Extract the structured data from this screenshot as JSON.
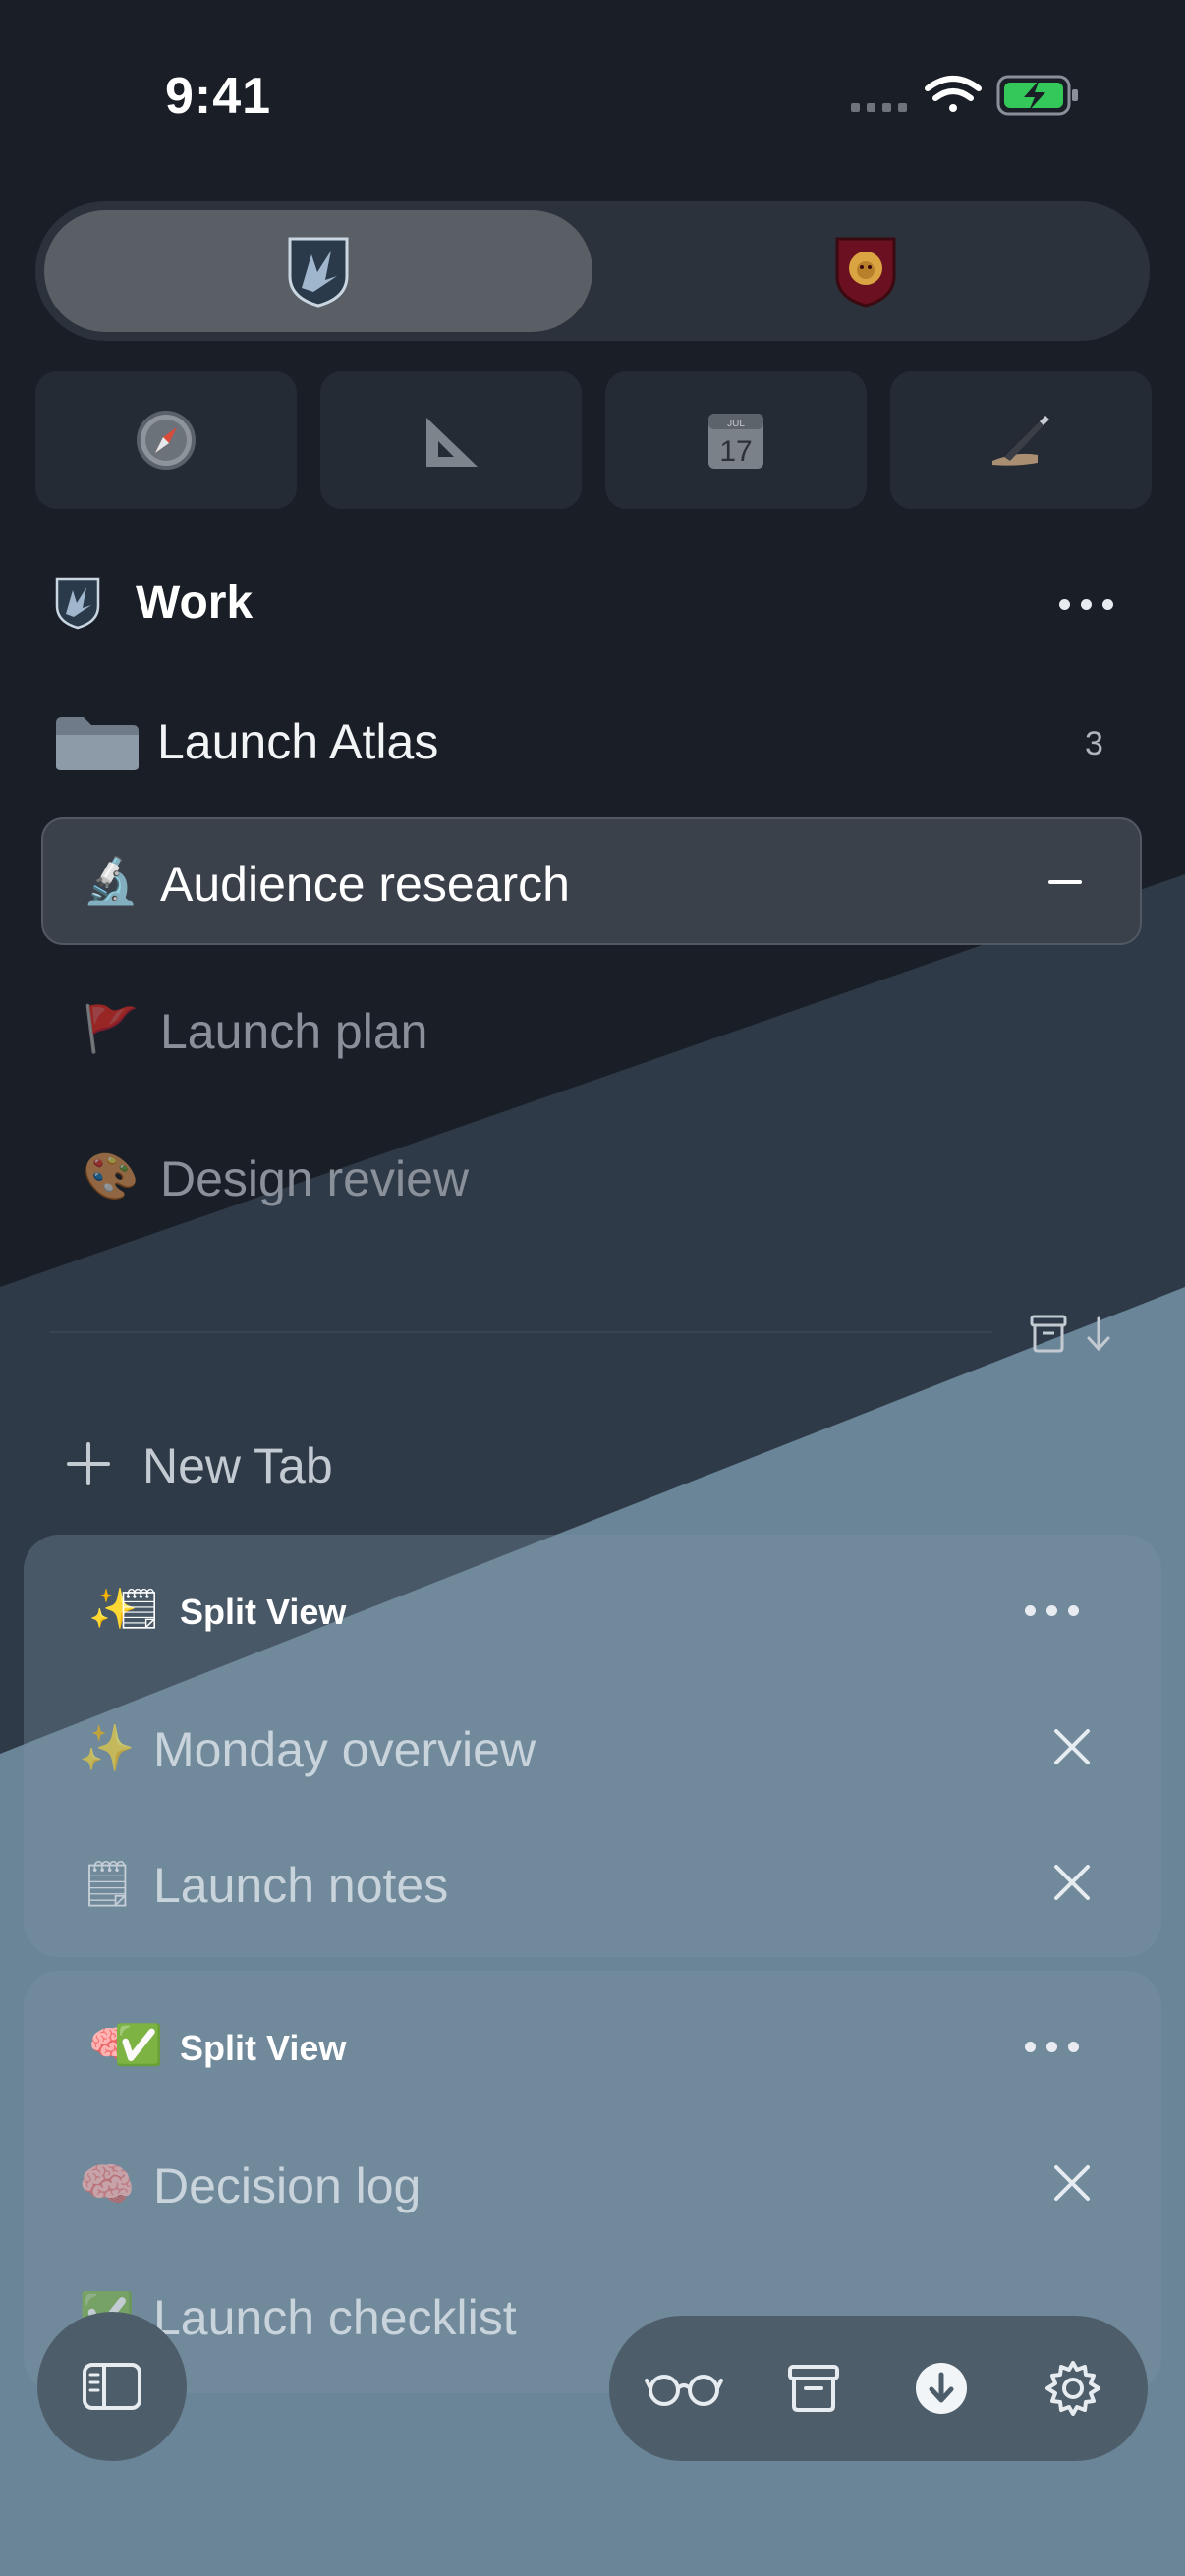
{
  "status_bar": {
    "time": "9:41",
    "icons": [
      "signal-dots-icon",
      "wifi-icon",
      "battery-charging-icon"
    ],
    "battery_color": "#34c759"
  },
  "profile_switcher": {
    "profiles": [
      {
        "icon": "bird-shield-icon",
        "selected": true
      },
      {
        "icon": "lion-shield-icon",
        "selected": false
      }
    ]
  },
  "quick_tiles": [
    {
      "icon": "compass-icon"
    },
    {
      "icon": "triangle-ruler-icon"
    },
    {
      "icon": "calendar-icon",
      "month": "JUL",
      "day": "17"
    },
    {
      "icon": "writing-hand-icon"
    }
  ],
  "space": {
    "title": "Work",
    "icon": "bird-shield-icon",
    "more_icon": "ellipsis-icon"
  },
  "folder": {
    "label": "Launch Atlas",
    "count": "3",
    "icon": "folder-icon"
  },
  "tabs": [
    {
      "emoji": "🔬",
      "label": "Audience research",
      "selected": true
    },
    {
      "emoji": "🚩",
      "label": "Launch plan",
      "selected": false
    },
    {
      "emoji": "🎨",
      "label": "Design review",
      "selected": false
    }
  ],
  "new_tab": {
    "label": "New Tab"
  },
  "split_views": [
    {
      "title": "Split View",
      "emojis": [
        "✨",
        "🗒"
      ],
      "items": [
        {
          "emoji": "✨",
          "label": "Monday overview"
        },
        {
          "emoji": "🗒",
          "label": "Launch notes"
        }
      ]
    },
    {
      "title": "Split View",
      "emojis": [
        "🧠",
        "✅"
      ],
      "items": [
        {
          "emoji": "🧠",
          "label": "Decision log"
        },
        {
          "emoji": "✅",
          "label": "Launch checklist"
        }
      ]
    }
  ],
  "toolbar": {
    "buttons": [
      "glasses-icon",
      "archive-icon",
      "download-icon",
      "gear-icon"
    ]
  },
  "colors": {
    "background_dark": "#1a1f27",
    "background_mid": "#2e3a47",
    "background_light": "#6a8597",
    "accent_red": "#6b1020",
    "accent_gold": "#d9a441"
  }
}
